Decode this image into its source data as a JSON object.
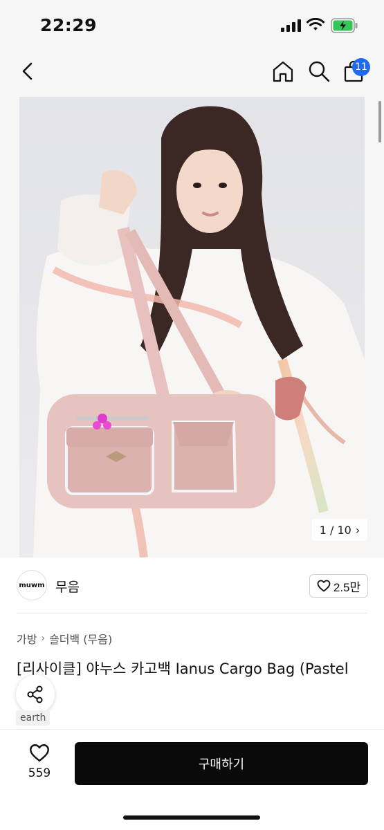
{
  "status_bar": {
    "time": "22:29"
  },
  "nav": {
    "back_icon": "chevron-left-icon",
    "home_icon": "home-icon",
    "search_icon": "search-icon",
    "cart_icon": "shopping-bag-icon",
    "cart_badge": "11"
  },
  "gallery": {
    "counter": "1 / 10",
    "counter_arrow": "›"
  },
  "seller": {
    "logo_text": "muwm",
    "name": "무음",
    "likes": "2.5만"
  },
  "breadcrumb": {
    "items": [
      "가방",
      "숄더백 (무음)"
    ],
    "separator": "›"
  },
  "product": {
    "title": "[리사이클] 야누스 카고백 Ianus Cargo Bag (Pastel Pink)",
    "tag": "earth"
  },
  "bottom_bar": {
    "wish_count": "559",
    "buy_label": "구매하기"
  },
  "colors": {
    "accent_badge": "#1e6bf0",
    "buy_button": "#0a0a0a",
    "battery_green": "#34c759"
  }
}
